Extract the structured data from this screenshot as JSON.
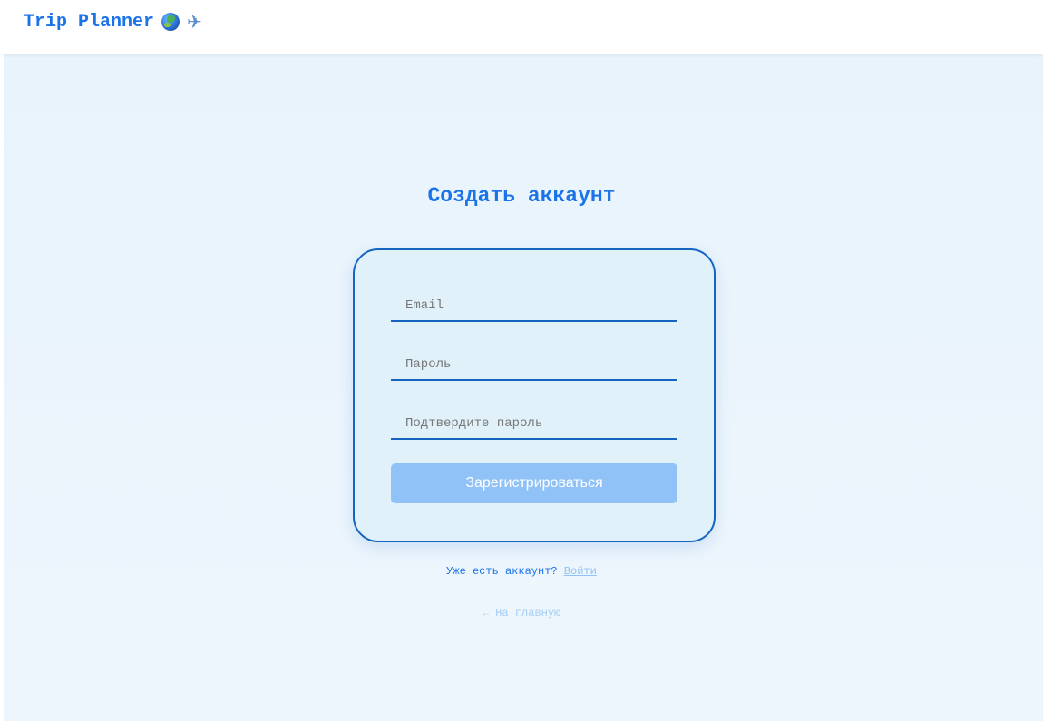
{
  "header": {
    "brand": "Trip Planner",
    "icons": [
      "globe-icon",
      "airplane-icon"
    ],
    "airplane_glyph": "✈"
  },
  "signup": {
    "title": "Создать аккаунт",
    "fields": {
      "email_placeholder": "Email",
      "password_placeholder": "Пароль",
      "confirm_placeholder": "Подтвердите пароль"
    },
    "submit_label": "Зарегистрироваться",
    "login_prompt": "Уже есть аккаунт?",
    "login_link": "Войти",
    "home_link": "← На главную"
  },
  "colors": {
    "accent": "#1a73e8",
    "card_border": "#1565c0",
    "button_disabled": "#90c2f8",
    "background": "#eaf4fc"
  }
}
